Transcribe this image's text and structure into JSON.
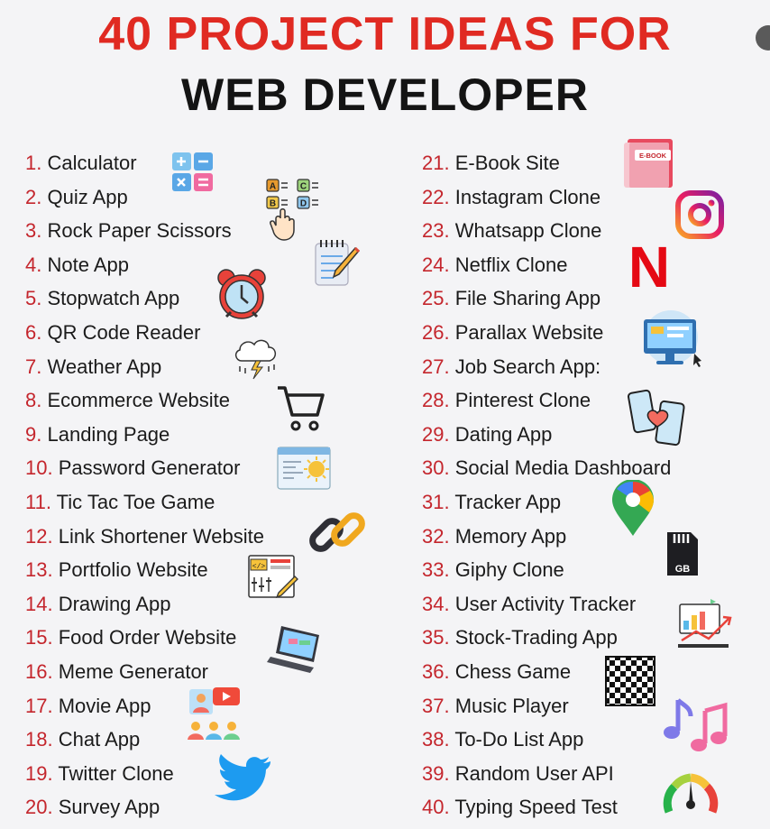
{
  "header": {
    "line1": "40 PROJECT IDEAS FOR",
    "line2": "WEB DEVELOPER"
  },
  "colors": {
    "title_accent": "#e02a22",
    "number": "#c4262d",
    "text": "#1b1b1b"
  },
  "left_items": [
    {
      "n": "1.",
      "t": "Calculator"
    },
    {
      "n": "2.",
      "t": "Quiz App"
    },
    {
      "n": "3.",
      "t": "Rock Paper Scissors"
    },
    {
      "n": "4.",
      "t": "Note App"
    },
    {
      "n": "5.",
      "t": "Stopwatch App"
    },
    {
      "n": "6.",
      "t": "QR Code Reader"
    },
    {
      "n": "7.",
      "t": "Weather App"
    },
    {
      "n": "8.",
      "t": "Ecommerce Website"
    },
    {
      "n": "9.",
      "t": "Landing Page"
    },
    {
      "n": "10.",
      "t": "Password Generator"
    },
    {
      "n": "11.",
      "t": "Tic Tac Toe Game"
    },
    {
      "n": "12.",
      "t": "Link Shortener Website"
    },
    {
      "n": "13.",
      "t": "Portfolio Website"
    },
    {
      "n": "14.",
      "t": "Drawing App"
    },
    {
      "n": "15.",
      "t": "Food Order Website"
    },
    {
      "n": "16.",
      "t": "Meme Generator"
    },
    {
      "n": "17.",
      "t": "Movie App"
    },
    {
      "n": "18.",
      "t": "Chat App"
    },
    {
      "n": "19.",
      "t": "Twitter Clone"
    },
    {
      "n": "20.",
      "t": "Survey App"
    }
  ],
  "right_items": [
    {
      "n": "21.",
      "t": "E-Book Site"
    },
    {
      "n": "22.",
      "t": "Instagram Clone"
    },
    {
      "n": "23.",
      "t": "Whatsapp Clone"
    },
    {
      "n": "24.",
      "t": "Netflix Clone"
    },
    {
      "n": "25.",
      "t": "File Sharing App"
    },
    {
      "n": "26.",
      "t": "Parallax Website"
    },
    {
      "n": "27.",
      "t": "Job Search App:"
    },
    {
      "n": "28.",
      "t": "Pinterest Clone"
    },
    {
      "n": "29.",
      "t": "Dating App"
    },
    {
      "n": "30.",
      "t": "Social Media Dashboard"
    },
    {
      "n": "31.",
      "t": "Tracker App"
    },
    {
      "n": "32.",
      "t": "Memory App"
    },
    {
      "n": "33.",
      "t": "Giphy Clone"
    },
    {
      "n": "34.",
      "t": "User Activity Tracker"
    },
    {
      "n": "35.",
      "t": "Stock-Trading App"
    },
    {
      "n": "36.",
      "t": "Chess Game"
    },
    {
      "n": "37.",
      "t": "Music Player"
    },
    {
      "n": "38.",
      "t": "To-Do List App"
    },
    {
      "n": "39.",
      "t": "Random User API"
    },
    {
      "n": "40.",
      "t": "Typing Speed Test"
    }
  ],
  "icon_labels": {
    "ebook": "E-BOOK",
    "netflix": "N",
    "sd_card": "GB"
  },
  "icons": [
    "calculator-icon",
    "quiz-icon",
    "hand-icon",
    "notepad-icon",
    "alarm-clock-icon",
    "storm-cloud-icon",
    "shopping-cart-icon",
    "browser-window-icon",
    "chain-link-icon",
    "code-editor-icon",
    "laptop-icon",
    "video-call-icon",
    "users-icon",
    "twitter-bird-icon",
    "ebook-icon",
    "instagram-icon",
    "netflix-icon",
    "monitor-icon",
    "phones-heart-icon",
    "map-pin-icon",
    "sd-card-icon",
    "analytics-icon",
    "chessboard-icon",
    "music-notes-icon",
    "speedometer-icon"
  ]
}
